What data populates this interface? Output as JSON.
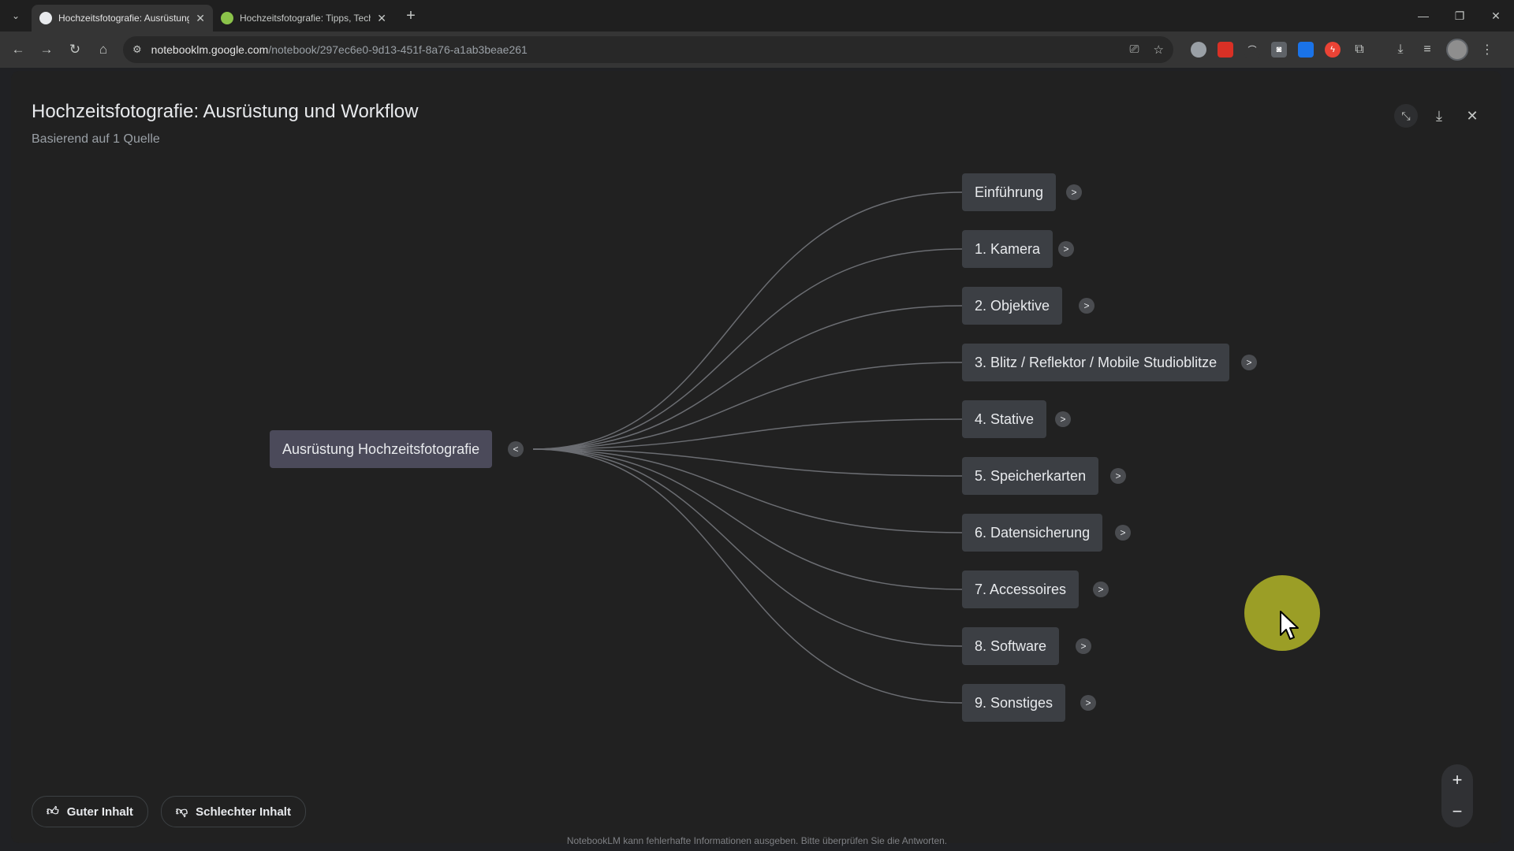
{
  "browser": {
    "tabs": [
      {
        "title": "Hochzeitsfotografie: Ausrüstung und Workflow",
        "favicon_color": "#e8eaed",
        "active": true
      },
      {
        "title": "Hochzeitsfotografie: Tipps, Technik",
        "favicon_color": "#8bc34a",
        "active": false
      }
    ],
    "url_host": "notebooklm.google.com",
    "url_path": "/notebook/297ec6e0-9d13-451f-8a76-a1ab3beae261"
  },
  "header": {
    "title": "Hochzeitsfotografie: Ausrüstung und Workflow",
    "subtitle": "Basierend auf 1 Quelle"
  },
  "mindmap": {
    "root": {
      "label": "Ausrüstung Hochzeitsfotografie",
      "toggle": "<"
    },
    "children": [
      {
        "label": "Einführung",
        "toggle": ">"
      },
      {
        "label": "1. Kamera",
        "toggle": ">"
      },
      {
        "label": "2. Objektive",
        "toggle": ">"
      },
      {
        "label": "3. Blitz / Reflektor / Mobile Studioblitze",
        "toggle": ">"
      },
      {
        "label": "4. Stative",
        "toggle": ">"
      },
      {
        "label": "5. Speicherkarten",
        "toggle": ">"
      },
      {
        "label": "6. Datensicherung",
        "toggle": ">"
      },
      {
        "label": "7. Accessoires",
        "toggle": ">"
      },
      {
        "label": "8. Software",
        "toggle": ">"
      },
      {
        "label": "9. Sonstiges",
        "toggle": ">"
      }
    ]
  },
  "feedback": {
    "good_label": "Guter Inhalt",
    "bad_label": "Schlechter Inhalt"
  },
  "zoom": {
    "in": "+",
    "out": "−"
  },
  "footer": {
    "disclaimer": "NotebookLM kann fehlerhafte Informationen ausgeben. Bitte überprüfen Sie die Antworten."
  },
  "colors": {
    "node_bg": "#3c3f44",
    "root_bg": "#4b4a5a",
    "connector": "#6b6d72",
    "cursor_highlight": "#c4c828"
  }
}
